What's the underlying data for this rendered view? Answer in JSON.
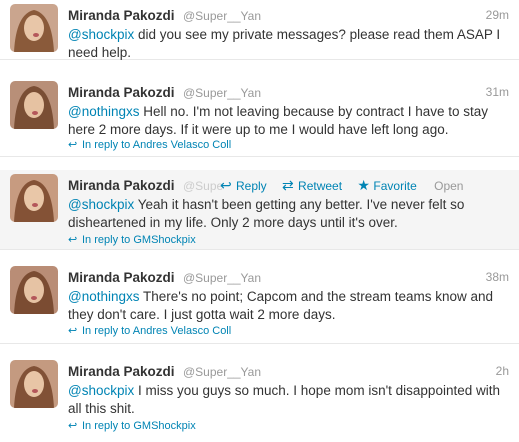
{
  "tweets": [
    {
      "name": "Miranda Pakozdi",
      "handle": "@Super__Yan",
      "time": "29m",
      "mention": "@shockpix",
      "text": " did you see my private messages? please read them ASAP I need help.",
      "reply_to": ""
    },
    {
      "name": "Miranda Pakozdi",
      "handle": "@Super__Yan",
      "time": "31m",
      "mention": "@nothingxs",
      "text": " Hell no. I'm not leaving because by contract I have to stay here 2 more days. If it were up to me I would have left long ago.",
      "reply_to": "In reply to Andres Velasco Coll"
    },
    {
      "name": "Miranda Pakozdi",
      "handle": "@Supe",
      "time": "",
      "mention": "@shockpix",
      "text": " Yeah it hasn't been getting any better. I've never felt so disheartened in my life. Only 2 more days until it's over.",
      "reply_to": "In reply to GMShockpix",
      "actions": {
        "reply": "Reply",
        "retweet": "Retweet",
        "favorite": "Favorite",
        "open": "Open"
      }
    },
    {
      "name": "Miranda Pakozdi",
      "handle": "@Super__Yan",
      "time": "38m",
      "mention": "@nothingxs",
      "text": " There's no point; Capcom and the stream teams know and they don't care. I just gotta wait 2 more days.",
      "reply_to": "In reply to Andres Velasco Coll"
    },
    {
      "name": "Miranda Pakozdi",
      "handle": "@Super__Yan",
      "time": "2h",
      "mention": "@shockpix",
      "text": " I miss you guys so much. I hope mom isn't disappointed with all this shit.",
      "reply_to": "In reply to GMShockpix"
    }
  ],
  "icons": {
    "reply": "reply-arrow-icon",
    "retweet": "retweet-icon",
    "favorite": "star-icon"
  },
  "colors": {
    "link": "#0084b4",
    "muted": "#999999",
    "text": "#333333",
    "hover": "#f5f5f5"
  }
}
